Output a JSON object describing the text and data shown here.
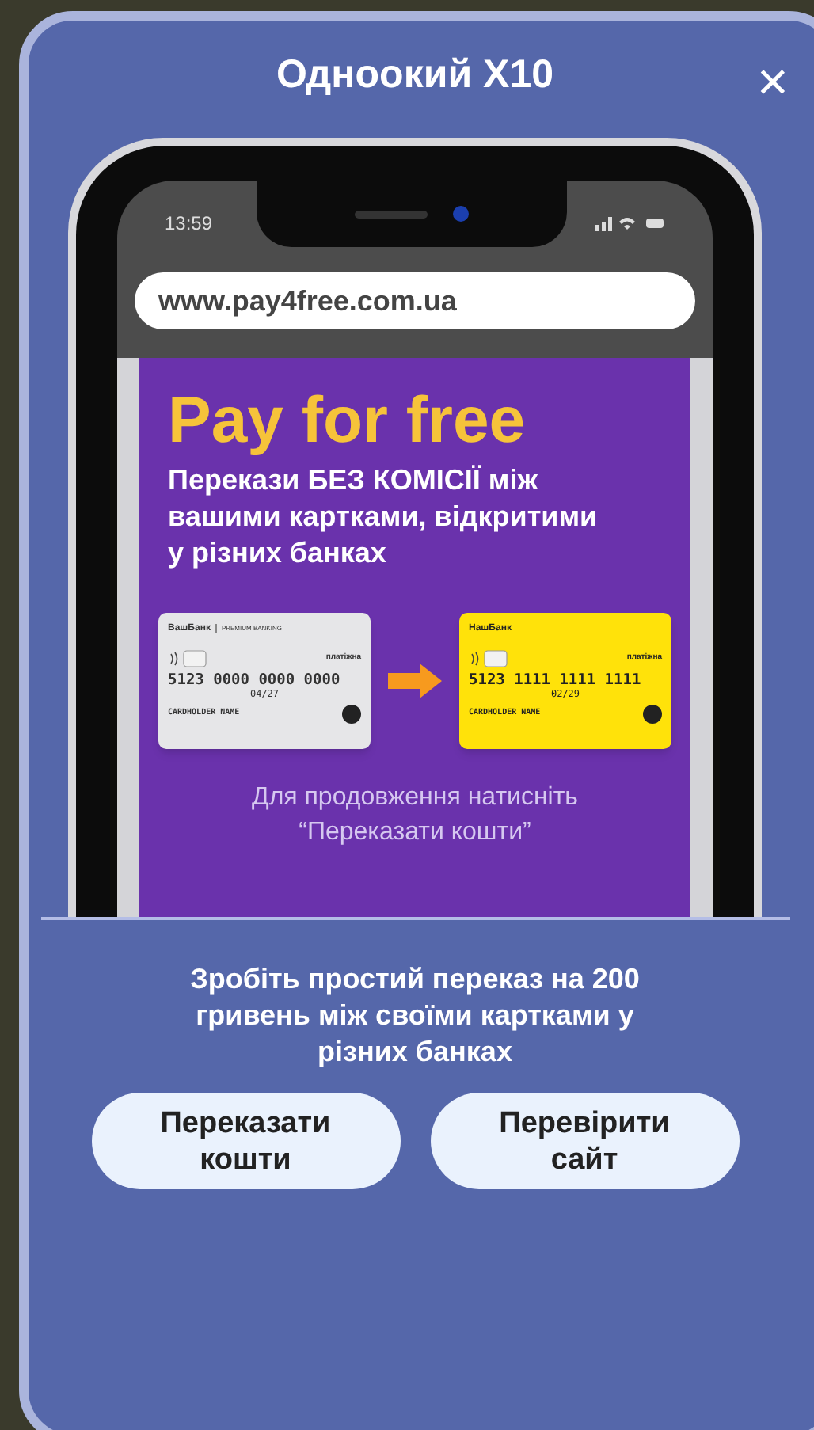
{
  "dialog": {
    "title": "Одноокий X10",
    "close": "×"
  },
  "phone": {
    "time": "13:59",
    "url": "www.pay4free.com.ua",
    "ad": {
      "headline": "Pay for free",
      "subtitle": "Перекази БЕЗ КОМІСІЇ між вашими картками, відкритими у різних банках",
      "cards": [
        {
          "kind": "source",
          "bank": "ВашБанк",
          "tier": "PREMIUM BANKING",
          "type": "платіжна",
          "number": "5123 0000 0000 0000",
          "expiry": "04/27",
          "holder": "CARDHOLDER NAME"
        },
        {
          "kind": "target",
          "bank": "НашБанк",
          "type": "платіжна",
          "number": "5123 1111 1111 1111",
          "expiry": "02/29",
          "holder": "CARDHOLDER NAME"
        }
      ],
      "hint_lines": [
        "Для продовження натисніть",
        "“Переказати кошти”"
      ]
    }
  },
  "task": "Зробіть простий переказ на 200 гривень між своїми картками у різних банках",
  "buttons": [
    {
      "label": "Переказати кошти"
    },
    {
      "label": "Перевірити сайт"
    }
  ]
}
